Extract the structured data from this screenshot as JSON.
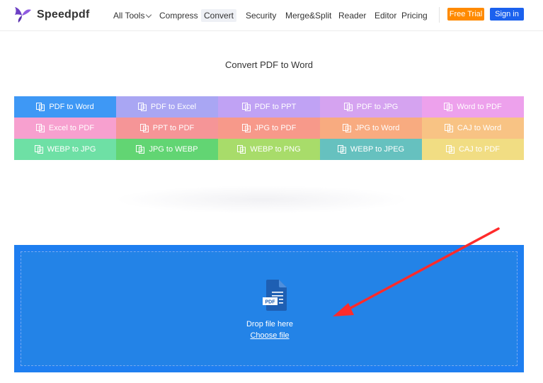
{
  "brand": {
    "name": "Speedpdf"
  },
  "nav": {
    "all_tools": "All Tools",
    "compress": "Compress",
    "convert": "Convert",
    "security": "Security",
    "merge_split": "Merge&Split",
    "reader": "Reader",
    "editor": "Editor",
    "pricing": "Pricing",
    "free_trial": "Free Trial",
    "sign_in": "Sign in"
  },
  "page": {
    "title": "Convert PDF to Word"
  },
  "tools": [
    {
      "label": "PDF to Word",
      "color": "#3e98f5"
    },
    {
      "label": "PDF to Excel",
      "color": "#a9a6f3"
    },
    {
      "label": "PDF to PPT",
      "color": "#c0a2f4"
    },
    {
      "label": "PDF to JPG",
      "color": "#d5a3f0"
    },
    {
      "label": "Word to PDF",
      "color": "#eda1ec"
    },
    {
      "label": "Excel to PDF",
      "color": "#f7a0cf"
    },
    {
      "label": "PPT to PDF",
      "color": "#f59597"
    },
    {
      "label": "JPG to PDF",
      "color": "#f7998a"
    },
    {
      "label": "JPG to Word",
      "color": "#f8ab80"
    },
    {
      "label": "CAJ to Word",
      "color": "#f8c384"
    },
    {
      "label": "WEBP to JPG",
      "color": "#6ee0a5"
    },
    {
      "label": "JPG to WEBP",
      "color": "#62d573"
    },
    {
      "label": "WEBP to PNG",
      "color": "#a8dc6a"
    },
    {
      "label": "WEBP to JPEG",
      "color": "#66c1bf"
    },
    {
      "label": "CAJ to PDF",
      "color": "#f1dd83"
    }
  ],
  "dropzone": {
    "drop_text": "Drop file here",
    "choose_text": "Choose file",
    "icon_text": "PDF"
  }
}
